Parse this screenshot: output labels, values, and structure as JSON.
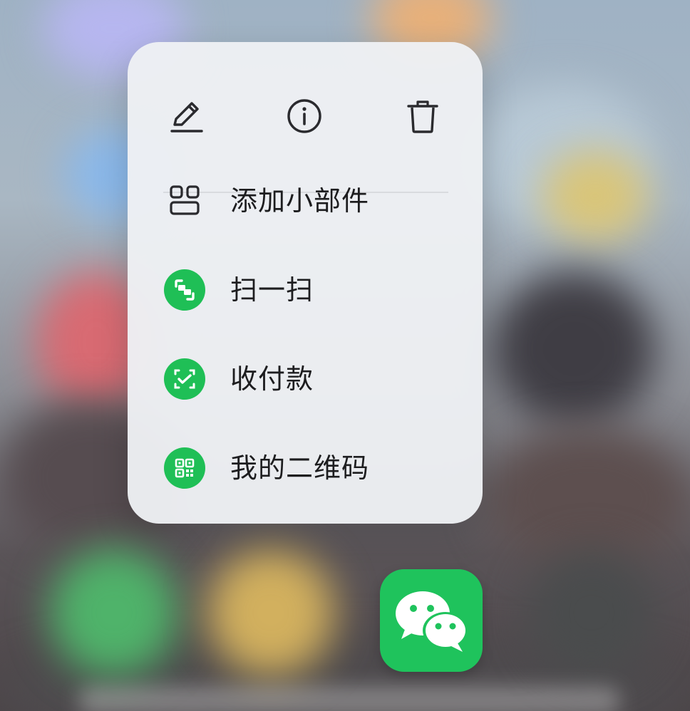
{
  "colors": {
    "accent_green": "#1fbf56",
    "menu_background": "#eef0f4",
    "text_primary": "#1d1d1f"
  },
  "top_actions": [
    {
      "id": "edit",
      "icon": "pencil-icon"
    },
    {
      "id": "info",
      "icon": "info-icon"
    },
    {
      "id": "delete",
      "icon": "trash-icon"
    }
  ],
  "menu_items": [
    {
      "label": "添加小部件",
      "icon": "widgets-icon"
    },
    {
      "label": "扫一扫",
      "icon": "scan-icon"
    },
    {
      "label": "收付款",
      "icon": "payment-icon"
    },
    {
      "label": "我的二维码",
      "icon": "qr-code-icon"
    }
  ],
  "app": {
    "icon": "wechat-icon"
  }
}
